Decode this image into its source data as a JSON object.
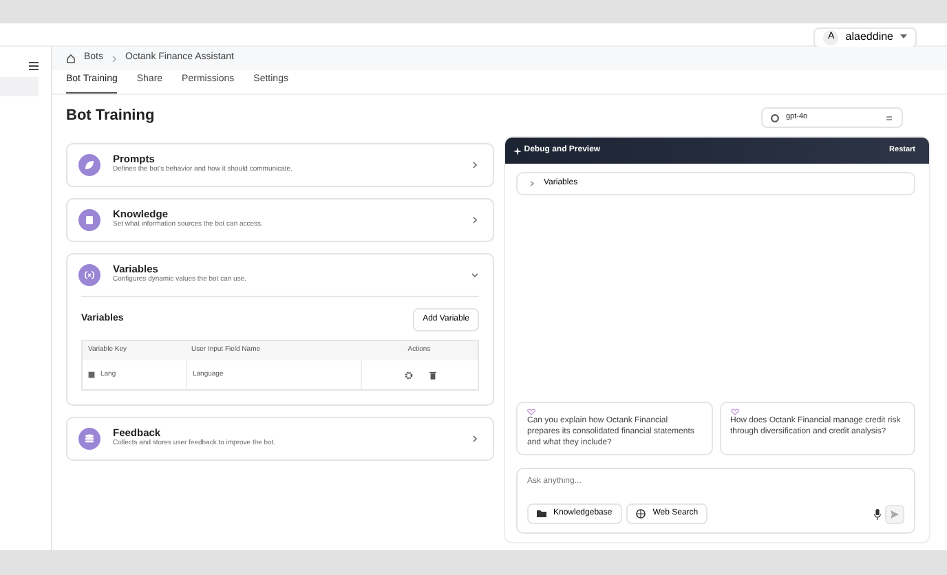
{
  "user": {
    "initial": "A",
    "name": "alaeddine"
  },
  "breadcrumb": [
    "Bots",
    "Octank Finance Assistant"
  ],
  "tabs": [
    {
      "label": "Bot Training",
      "selected": true
    },
    {
      "label": "Share",
      "selected": false
    },
    {
      "label": "Permissions",
      "selected": false
    },
    {
      "label": "Settings",
      "selected": false
    }
  ],
  "page_title": "Bot Training",
  "model": "gpt-4o",
  "sections": [
    {
      "kind": "prompts",
      "title": "Prompts",
      "description": "Defines the bot's behavior and how it should communicate.",
      "expanded": false
    },
    {
      "kind": "knowledge",
      "title": "Knowledge",
      "description": "Set what information sources the bot can access.",
      "expanded": false
    },
    {
      "kind": "variables",
      "title": "Variables",
      "description": "Configures dynamic values the bot can use.",
      "expanded": true,
      "heading": "Variables",
      "add_button": "Add Variable",
      "columns": [
        "Variable Key",
        "User Input Field Name",
        "Actions"
      ],
      "rows": [
        {
          "key": "Lang",
          "field_name": "Language"
        }
      ]
    },
    {
      "kind": "feedback",
      "title": "Feedback",
      "description": "Collects and stores user feedback to improve the bot.",
      "expanded": false
    }
  ],
  "preview": {
    "title": "Debug and Preview",
    "restart": "Restart",
    "variables_label": "Variables",
    "variables_expanded": false,
    "suggestions": [
      "Can you explain how Octank Financial prepares its consolidated financial statements and what they include?",
      "How does Octank Financial manage credit risk through diversification and credit analysis?"
    ],
    "input_placeholder": "Ask anything...",
    "tools": [
      {
        "kind": "folder",
        "label": "Knowledgebase"
      },
      {
        "kind": "globe",
        "label": "Web Search"
      }
    ]
  }
}
